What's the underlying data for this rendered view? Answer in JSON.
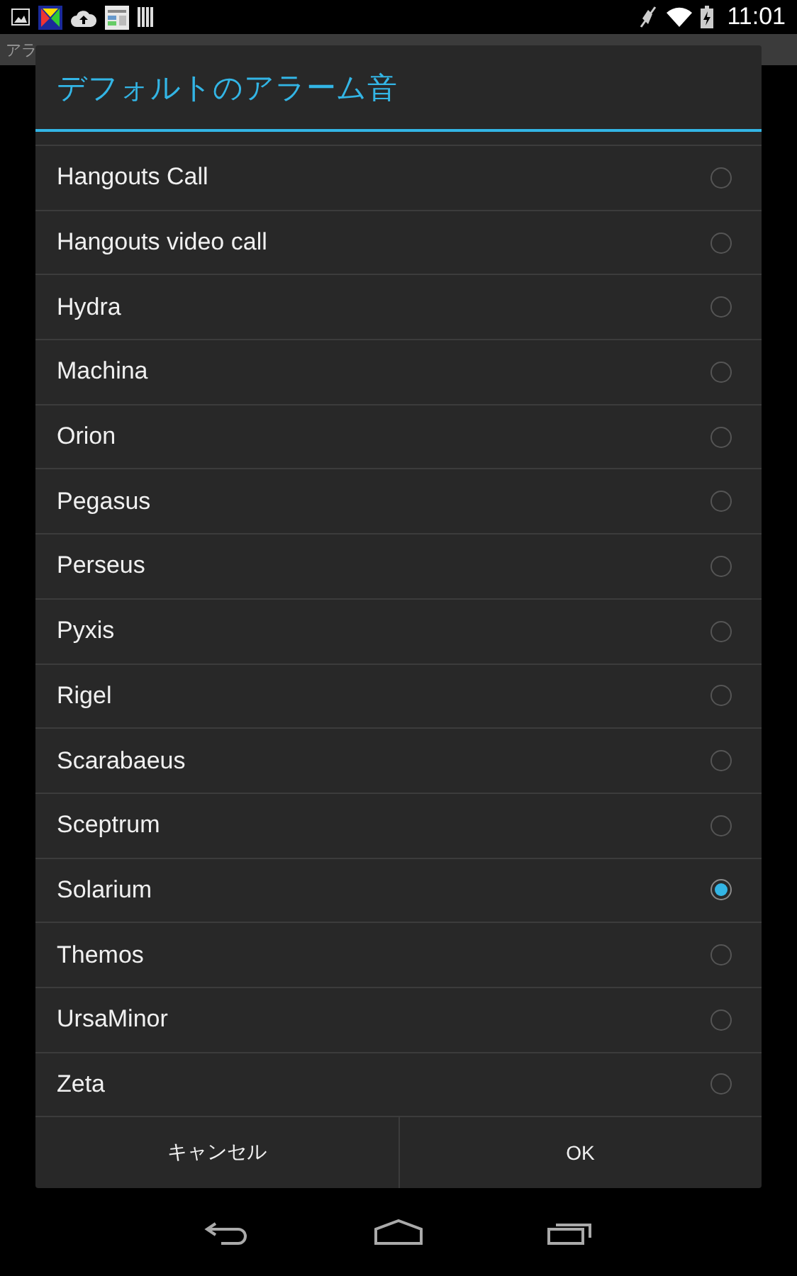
{
  "status_bar": {
    "time": "11:01"
  },
  "app_bar": {
    "title": "アラ"
  },
  "dialog": {
    "title": "デフォルトのアラーム音",
    "items": [
      {
        "label": "Hangouts Call",
        "selected": false
      },
      {
        "label": "Hangouts video call",
        "selected": false
      },
      {
        "label": "Hydra",
        "selected": false
      },
      {
        "label": "Machina",
        "selected": false
      },
      {
        "label": "Orion",
        "selected": false
      },
      {
        "label": "Pegasus",
        "selected": false
      },
      {
        "label": "Perseus",
        "selected": false
      },
      {
        "label": "Pyxis",
        "selected": false
      },
      {
        "label": "Rigel",
        "selected": false
      },
      {
        "label": "Scarabaeus",
        "selected": false
      },
      {
        "label": "Sceptrum",
        "selected": false
      },
      {
        "label": "Solarium",
        "selected": true
      },
      {
        "label": "Themos",
        "selected": false
      },
      {
        "label": "UrsaMinor",
        "selected": false
      },
      {
        "label": "Zeta",
        "selected": false
      }
    ],
    "buttons": [
      "キャンセル",
      "OK"
    ]
  }
}
